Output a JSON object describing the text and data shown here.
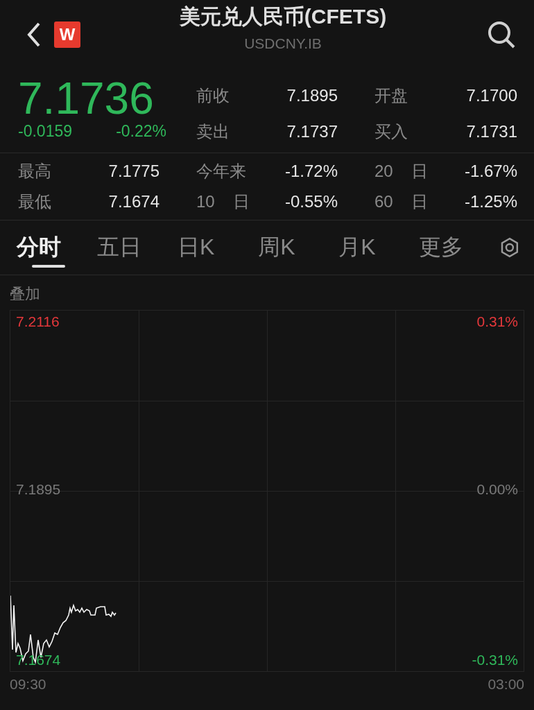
{
  "header": {
    "title": "美元兑人民币(CFETS)",
    "code": "USDCNY.IB",
    "logo": "W"
  },
  "quote": {
    "price": "7.1736",
    "change": "-0.0159",
    "change_pct": "-0.22%"
  },
  "quote_fields": [
    {
      "label": "前收",
      "value": "7.1895"
    },
    {
      "label": "开盘",
      "value": "7.1700"
    },
    {
      "label": "卖出",
      "value": "7.1737"
    },
    {
      "label": "买入",
      "value": "7.1731"
    }
  ],
  "stats": [
    [
      {
        "label": "最高",
        "value": "7.1775"
      },
      {
        "label": "今年来",
        "value": "-1.72%"
      },
      {
        "label": "20 日",
        "value": "-1.67%"
      }
    ],
    [
      {
        "label": "最低",
        "value": "7.1674"
      },
      {
        "label": "10 日",
        "value": "-0.55%"
      },
      {
        "label": "60 日",
        "value": "-1.25%"
      }
    ]
  ],
  "tabs": [
    {
      "label": "分时",
      "selected": true
    },
    {
      "label": "五日",
      "selected": false
    },
    {
      "label": "日K",
      "selected": false
    },
    {
      "label": "周K",
      "selected": false
    },
    {
      "label": "月K",
      "selected": false
    },
    {
      "label": "更多",
      "selected": false
    }
  ],
  "overlay_label": "叠加",
  "chart": {
    "levels": [
      {
        "price": "7.2116",
        "pct": "0.31%",
        "color": "#e5383b"
      },
      {
        "price": "7.1895",
        "pct": "0.00%",
        "color": "#7a7a7a"
      },
      {
        "price": "7.1674",
        "pct": "-0.31%",
        "color": "#2fb85a"
      }
    ],
    "times": [
      "09:30",
      "03:00"
    ]
  }
}
